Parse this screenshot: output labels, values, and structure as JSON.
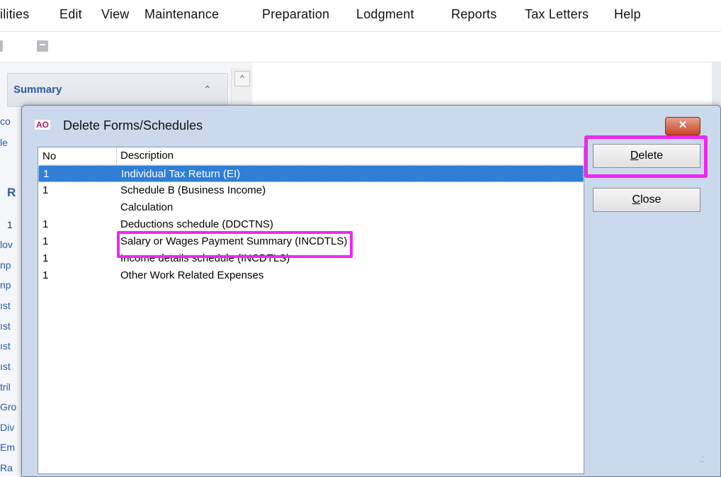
{
  "menu": {
    "items": [
      "ilities",
      "Edit",
      "View",
      "Maintenance",
      "Preparation",
      "Lodgment",
      "Reports",
      "Tax Letters",
      "Help"
    ]
  },
  "background": {
    "summary_title": "Summary",
    "r_header": "R",
    "left_fragments": [
      "co",
      "le",
      "1",
      "lov",
      "np",
      "np",
      "ıst",
      "ıst",
      "ıst",
      "ıst",
      "tril",
      "Gro",
      "Div",
      "Em",
      "Ra"
    ]
  },
  "dialog": {
    "app_icon": "AO",
    "title": "Delete Forms/Schedules",
    "close_glyph": "✕",
    "columns": {
      "no": "No",
      "description": "Description"
    },
    "rows": [
      {
        "no": "1",
        "description": "Individual Tax Return (EI)",
        "selected": true
      },
      {
        "no": "1",
        "description": "Schedule B (Business Income)",
        "selected": false
      },
      {
        "no": "",
        "description": "Calculation",
        "selected": false
      },
      {
        "no": "1",
        "description": "Deductions schedule (DDCTNS)",
        "selected": false
      },
      {
        "no": "1",
        "description": "Salary or Wages Payment Summary (INCDTLS)",
        "selected": false
      },
      {
        "no": "1",
        "description": "Income details schedule (INCDTLS)",
        "selected": false
      },
      {
        "no": "1",
        "description": "Other Work Related Expenses",
        "selected": false
      }
    ],
    "buttons": {
      "delete_mnemonic": "D",
      "delete_rest": "elete",
      "close_mnemonic": "C",
      "close_rest": "lose"
    }
  },
  "colors": {
    "highlight": "#ee28ee",
    "selection": "#2f7fd6",
    "dialog_bg": "#cad9ec"
  }
}
